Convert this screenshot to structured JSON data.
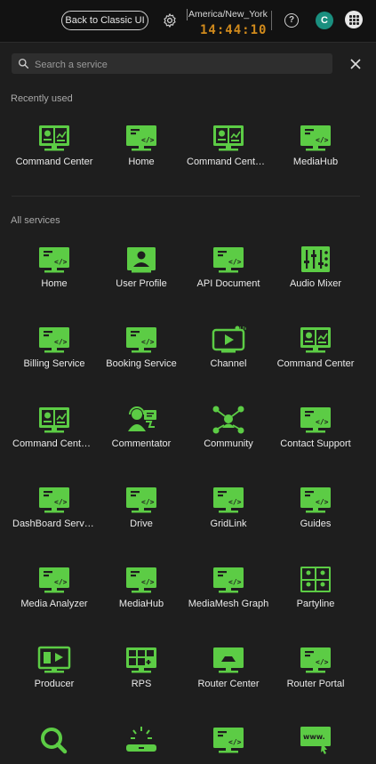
{
  "topbar": {
    "classic_button": "Back to Classic UI",
    "timezone": "America/New_York",
    "clock": "14:44:10",
    "help": "?",
    "avatar_initial": "C"
  },
  "search": {
    "placeholder": "Search a service",
    "value": ""
  },
  "colors": {
    "accent": "#5ccc45",
    "avatar": "#1a8f7f",
    "clock": "#d08a1c"
  },
  "recent": {
    "title": "Recently used",
    "items": [
      {
        "label": "Command Center",
        "icon": "dashboard-monitor-icon"
      },
      {
        "label": "Home",
        "icon": "code-monitor-icon"
      },
      {
        "label": "Command Center...",
        "icon": "dashboard-monitor-icon"
      },
      {
        "label": "MediaHub",
        "icon": "code-monitor-icon"
      }
    ]
  },
  "all": {
    "title": "All services",
    "items": [
      {
        "label": "Home",
        "icon": "code-monitor-icon"
      },
      {
        "label": "User Profile",
        "icon": "user-profile-icon"
      },
      {
        "label": "API Document",
        "icon": "code-monitor-icon"
      },
      {
        "label": "Audio Mixer",
        "icon": "audio-mixer-icon"
      },
      {
        "label": "Billing Service",
        "icon": "code-monitor-icon"
      },
      {
        "label": "Booking Service",
        "icon": "code-monitor-icon"
      },
      {
        "label": "Channel",
        "icon": "live-channel-icon"
      },
      {
        "label": "Command Center",
        "icon": "dashboard-monitor-icon"
      },
      {
        "label": "Command Center...",
        "icon": "dashboard-monitor-icon"
      },
      {
        "label": "Commentator",
        "icon": "commentator-icon"
      },
      {
        "label": "Community",
        "icon": "community-icon"
      },
      {
        "label": "Contact Support",
        "icon": "code-monitor-icon"
      },
      {
        "label": "DashBoard Service",
        "icon": "code-monitor-icon"
      },
      {
        "label": "Drive",
        "icon": "code-monitor-icon"
      },
      {
        "label": "GridLink",
        "icon": "code-monitor-icon"
      },
      {
        "label": "Guides",
        "icon": "code-monitor-icon"
      },
      {
        "label": "Media Analyzer",
        "icon": "code-monitor-icon"
      },
      {
        "label": "MediaHub",
        "icon": "code-monitor-icon"
      },
      {
        "label": "MediaMesh Graph",
        "icon": "code-monitor-icon"
      },
      {
        "label": "Partyline",
        "icon": "partyline-icon"
      },
      {
        "label": "Producer",
        "icon": "producer-icon"
      },
      {
        "label": "RPS",
        "icon": "rps-icon"
      },
      {
        "label": "Router Center",
        "icon": "router-center-icon"
      },
      {
        "label": "Router Portal",
        "icon": "code-monitor-icon"
      },
      {
        "label": "",
        "icon": "search-service-icon"
      },
      {
        "label": "",
        "icon": "scan-device-icon"
      },
      {
        "label": "",
        "icon": "code-monitor-icon"
      },
      {
        "label": "",
        "icon": "web-icon"
      }
    ]
  }
}
